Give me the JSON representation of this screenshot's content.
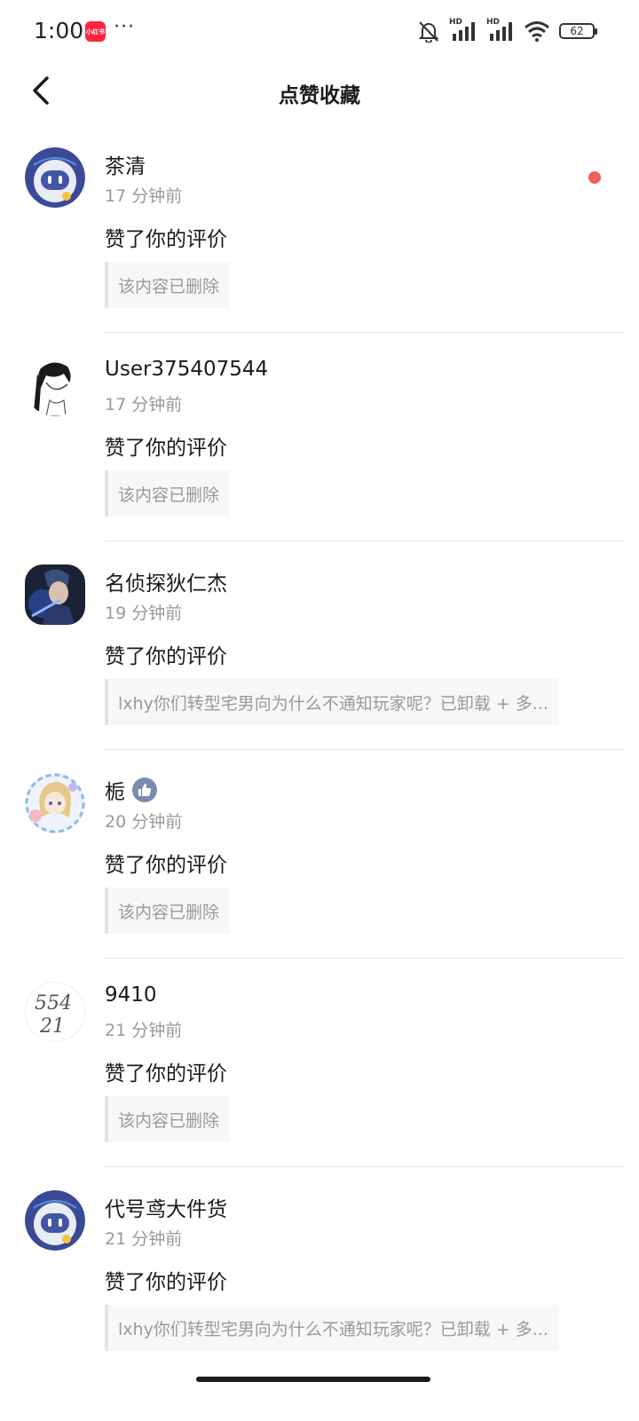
{
  "status_bar": {
    "time": "1:00",
    "app_badge": "小红书",
    "more": "···",
    "battery": "62",
    "network_label_1": "HD",
    "network_label_2": "HD"
  },
  "header": {
    "title": "点赞收藏"
  },
  "notifications": [
    {
      "user": "茶清",
      "time": "17 分钟前",
      "action": "赞了你的评价",
      "quote": "该内容已删除",
      "unread": true,
      "avatar": "robot-avatar"
    },
    {
      "user": "User375407544",
      "time": "17 分钟前",
      "action": "赞了你的评价",
      "quote": "该内容已删除",
      "unread": false,
      "avatar": "sketch-avatar"
    },
    {
      "user": "名侦探狄仁杰",
      "time": "19 分钟前",
      "action": "赞了你的评价",
      "quote": "lxhy你们转型宅男向为什么不通知玩家呢？已卸载 + 多...",
      "unread": false,
      "avatar": "game-hero-avatar"
    },
    {
      "user": "栀",
      "time": "20 分钟前",
      "action": "赞了你的评价",
      "quote": "该内容已删除",
      "unread": false,
      "avatar": "anime-girl-avatar",
      "badge": "thumbs-up-icon"
    },
    {
      "user": "9410",
      "time": "21 分钟前",
      "action": "赞了你的评价",
      "quote": "该内容已删除",
      "unread": false,
      "avatar": "handwriting-avatar",
      "avatar_text_1": "554",
      "avatar_text_2": "21"
    },
    {
      "user": "代号鸢大件货",
      "time": "21 分钟前",
      "action": "赞了你的评价",
      "quote": "lxhy你们转型宅男向为什么不通知玩家呢？已卸载 + 多...",
      "unread": false,
      "avatar": "robot-avatar"
    }
  ],
  "colors": {
    "unread_dot": "#f0605a",
    "app_badge": "#ff2442",
    "like_badge": "#7b8bb0"
  }
}
